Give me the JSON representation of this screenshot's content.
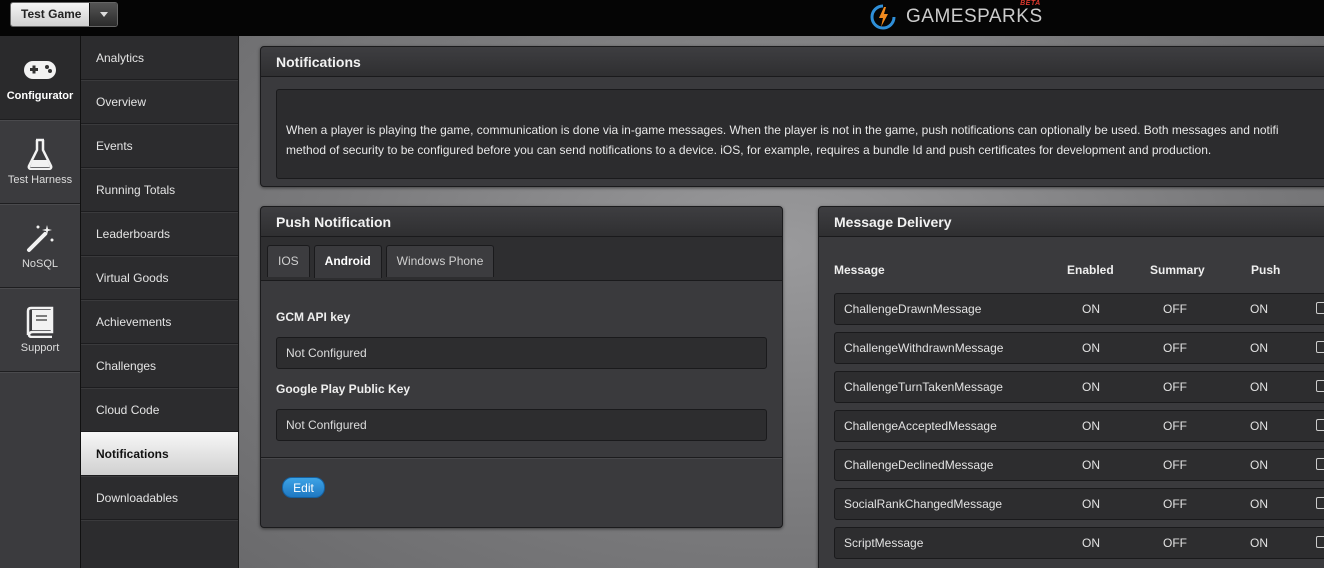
{
  "topbar": {
    "game_name": "Test Game",
    "logo_text": "GAMESPARKS",
    "logo_beta": "BETA"
  },
  "rail": {
    "items": [
      {
        "label": "Configurator",
        "icon": "gamepad-icon"
      },
      {
        "label": "Test Harness",
        "icon": "flask-icon"
      },
      {
        "label": "NoSQL",
        "icon": "magic-wand-icon"
      },
      {
        "label": "Support",
        "icon": "book-icon"
      }
    ]
  },
  "subnav": {
    "items": [
      {
        "label": "Analytics"
      },
      {
        "label": "Overview"
      },
      {
        "label": "Events"
      },
      {
        "label": "Running Totals"
      },
      {
        "label": "Leaderboards"
      },
      {
        "label": "Virtual Goods"
      },
      {
        "label": "Achievements"
      },
      {
        "label": "Challenges"
      },
      {
        "label": "Cloud Code"
      },
      {
        "label": "Notifications"
      },
      {
        "label": "Downloadables"
      }
    ]
  },
  "notifications": {
    "title": "Notifications",
    "line1": "When a player is playing the game, communication is done via in-game messages. When the player is not in the game, push notifications can optionally be used. Both messages and notifi",
    "line2": "method of security to be configured before you can send notifications to a device. iOS, for example, requires a bundle Id and push certificates for development and production."
  },
  "push": {
    "title": "Push Notification",
    "tabs": [
      {
        "label": "IOS"
      },
      {
        "label": "Android"
      },
      {
        "label": "Windows Phone"
      }
    ],
    "gcm_label": "GCM API key",
    "gcm_value": "Not Configured",
    "gplay_label": "Google Play Public Key",
    "gplay_value": "Not Configured",
    "edit_label": "Edit"
  },
  "delivery": {
    "title": "Message Delivery",
    "columns": {
      "message": "Message",
      "enabled": "Enabled",
      "summary": "Summary",
      "push": "Push"
    },
    "rows": [
      {
        "message": "ChallengeDrawnMessage",
        "enabled": "ON",
        "summary": "OFF",
        "push": "ON"
      },
      {
        "message": "ChallengeWithdrawnMessage",
        "enabled": "ON",
        "summary": "OFF",
        "push": "ON"
      },
      {
        "message": "ChallengeTurnTakenMessage",
        "enabled": "ON",
        "summary": "OFF",
        "push": "ON"
      },
      {
        "message": "ChallengeAcceptedMessage",
        "enabled": "ON",
        "summary": "OFF",
        "push": "ON"
      },
      {
        "message": "ChallengeDeclinedMessage",
        "enabled": "ON",
        "summary": "OFF",
        "push": "ON"
      },
      {
        "message": "SocialRankChangedMessage",
        "enabled": "ON",
        "summary": "OFF",
        "push": "ON"
      },
      {
        "message": "ScriptMessage",
        "enabled": "ON",
        "summary": "OFF",
        "push": "ON"
      }
    ]
  },
  "colors": {
    "accent_blue": "#2a8ad6",
    "logo_orange": "#f28a1e",
    "logo_blue": "#2f8fd8",
    "beta_red": "#e03a2e"
  }
}
